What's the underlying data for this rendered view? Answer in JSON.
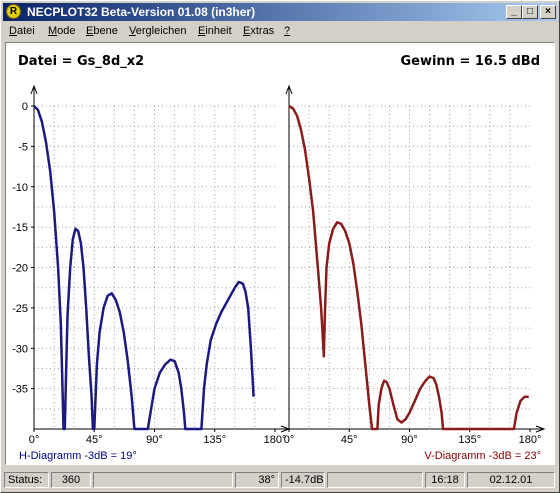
{
  "window": {
    "title": "NECPLOT32  Beta-Version 01.08 (in3her)",
    "icon_letter": "R",
    "controls": {
      "minimize": "_",
      "maximize": "□",
      "close": "×"
    }
  },
  "menu": [
    {
      "label": "Datei",
      "mnemonic": "D"
    },
    {
      "label": "Mode",
      "mnemonic": "M"
    },
    {
      "label": "Ebene",
      "mnemonic": "E"
    },
    {
      "label": "Vergleichen",
      "mnemonic": "V"
    },
    {
      "label": "Einheit",
      "mnemonic": "E"
    },
    {
      "label": "Extras",
      "mnemonic": "E"
    },
    {
      "label": "?",
      "mnemonic": "?"
    }
  ],
  "plot": {
    "file_label": "Datei = Gs_8d_x2",
    "gain_label": "Gewinn =  16.5 dBd",
    "h_caption": "H-Diagramm -3dB = 19°",
    "v_caption": "V-Diagramm -3dB = 23°"
  },
  "status": {
    "label": "Status:",
    "code": "360",
    "angle": "38°",
    "level": "-14.7dB",
    "time": "16:18",
    "date": "02.12.01"
  },
  "chart_data": [
    {
      "type": "line",
      "name": "H-Diagramm",
      "color": "#1a1a80",
      "xlim": [
        0,
        180
      ],
      "ylim": [
        -40,
        0
      ],
      "x_ticks": [
        "0°",
        "45°",
        "90°",
        "135°",
        "180°"
      ],
      "y_ticks": [
        "0",
        "-5",
        "-10",
        "-15",
        "-20",
        "-25",
        "-30",
        "-35"
      ],
      "grid": true,
      "points": [
        [
          0,
          0
        ],
        [
          3,
          -0.5
        ],
        [
          6,
          -2
        ],
        [
          9,
          -4.5
        ],
        [
          12,
          -8
        ],
        [
          15,
          -13
        ],
        [
          18,
          -20
        ],
        [
          20,
          -27
        ],
        [
          21,
          -33
        ],
        [
          22,
          -40
        ],
        [
          23,
          -40
        ],
        [
          24,
          -33
        ],
        [
          25,
          -26
        ],
        [
          27,
          -20
        ],
        [
          29,
          -16.5
        ],
        [
          31,
          -15.2
        ],
        [
          33,
          -15.5
        ],
        [
          35,
          -17
        ],
        [
          37,
          -20
        ],
        [
          39,
          -25
        ],
        [
          41,
          -31
        ],
        [
          43,
          -36
        ],
        [
          44,
          -40
        ],
        [
          45,
          -40
        ],
        [
          46,
          -36
        ],
        [
          47,
          -32
        ],
        [
          49,
          -28
        ],
        [
          52,
          -25
        ],
        [
          55,
          -23.5
        ],
        [
          58,
          -23.2
        ],
        [
          61,
          -24
        ],
        [
          64,
          -25.5
        ],
        [
          67,
          -28
        ],
        [
          70,
          -31.5
        ],
        [
          73,
          -36
        ],
        [
          75,
          -40
        ],
        [
          85,
          -40
        ],
        [
          87,
          -38
        ],
        [
          90,
          -35
        ],
        [
          94,
          -33
        ],
        [
          98,
          -32
        ],
        [
          102,
          -31.4
        ],
        [
          105,
          -31.6
        ],
        [
          108,
          -33
        ],
        [
          110,
          -35
        ],
        [
          112,
          -38
        ],
        [
          113,
          -40
        ],
        [
          125,
          -40
        ],
        [
          127,
          -35
        ],
        [
          129,
          -32
        ],
        [
          132,
          -29
        ],
        [
          136,
          -27
        ],
        [
          140,
          -25.5
        ],
        [
          145,
          -24
        ],
        [
          150,
          -22.5
        ],
        [
          153,
          -21.8
        ],
        [
          156,
          -22
        ],
        [
          158,
          -23
        ],
        [
          160,
          -25
        ],
        [
          162,
          -30
        ],
        [
          164,
          -36
        ]
      ]
    },
    {
      "type": "line",
      "name": "V-Diagramm",
      "color": "#8b1a1a",
      "xlim": [
        0,
        180
      ],
      "ylim": [
        -40,
        0
      ],
      "x_ticks": [
        "0°",
        "45°",
        "90°",
        "135°",
        "180°"
      ],
      "grid": true,
      "points": [
        [
          0,
          0
        ],
        [
          3,
          -0.3
        ],
        [
          6,
          -1.2
        ],
        [
          9,
          -3
        ],
        [
          12,
          -5.5
        ],
        [
          15,
          -9
        ],
        [
          18,
          -13
        ],
        [
          20,
          -17
        ],
        [
          22,
          -21
        ],
        [
          24,
          -25
        ],
        [
          25,
          -28
        ],
        [
          26,
          -31
        ],
        [
          27,
          -25
        ],
        [
          28,
          -20
        ],
        [
          30,
          -17
        ],
        [
          33,
          -15.2
        ],
        [
          36,
          -14.4
        ],
        [
          39,
          -14.6
        ],
        [
          42,
          -15.5
        ],
        [
          45,
          -17
        ],
        [
          48,
          -19.5
        ],
        [
          51,
          -23
        ],
        [
          54,
          -27
        ],
        [
          57,
          -32
        ],
        [
          60,
          -37
        ],
        [
          62,
          -40
        ],
        [
          66,
          -40
        ],
        [
          67,
          -37
        ],
        [
          69,
          -35
        ],
        [
          71,
          -34
        ],
        [
          73,
          -34.2
        ],
        [
          75,
          -35
        ],
        [
          78,
          -37
        ],
        [
          81,
          -38.8
        ],
        [
          84,
          -39.2
        ],
        [
          87,
          -38.8
        ],
        [
          90,
          -38
        ],
        [
          94,
          -36.5
        ],
        [
          98,
          -35
        ],
        [
          102,
          -34
        ],
        [
          105,
          -33.5
        ],
        [
          108,
          -33.7
        ],
        [
          110,
          -34.5
        ],
        [
          112,
          -36
        ],
        [
          114,
          -38
        ],
        [
          115,
          -40
        ],
        [
          168,
          -40
        ],
        [
          170,
          -38
        ],
        [
          173,
          -36.5
        ],
        [
          176,
          -36
        ],
        [
          179,
          -36
        ]
      ]
    }
  ]
}
